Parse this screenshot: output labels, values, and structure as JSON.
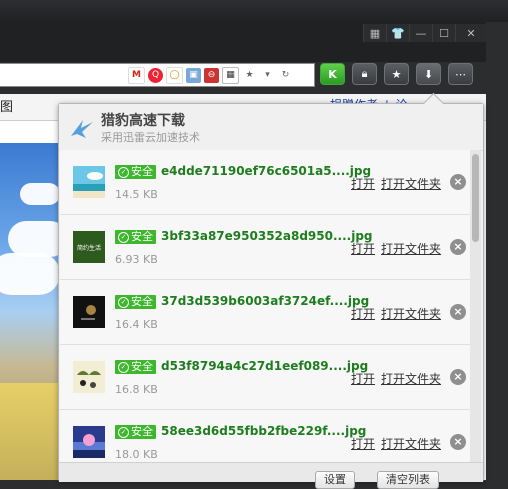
{
  "browser": {
    "window_buttons": [
      "▦",
      "👕",
      "—",
      "☐",
      "✕"
    ],
    "toolbar": {
      "k_label": "K",
      "lock_icon": "lock-icon",
      "star_icon": "star-icon",
      "download_icon": "download-icon",
      "menu_icon": "menu-icon"
    },
    "bookmarks": {
      "left_text": "图",
      "right_text": "捐赠作者  ↓ 论"
    }
  },
  "panel": {
    "title": "猎豹高速下载",
    "subtitle": "采用迅雷云加速技术",
    "safe_label": "安全",
    "open_label": "打开",
    "open_folder_label": "打开文件夹",
    "items": [
      {
        "name": "e4dde71190ef76c6501a5....jpg",
        "size": "14.5 KB",
        "thumb_text": ""
      },
      {
        "name": "3bf33a87e950352a8d950....jpg",
        "size": "6.93 KB",
        "thumb_text": "简约生活"
      },
      {
        "name": "37d3d539b6003af3724ef....jpg",
        "size": "16.4 KB",
        "thumb_text": ""
      },
      {
        "name": "d53f8794a4c27d1eef089....jpg",
        "size": "16.8 KB",
        "thumb_text": ""
      },
      {
        "name": "58ee3d6d55fbb2fbe229f....jpg",
        "size": "18.0 KB",
        "thumb_text": ""
      }
    ],
    "footer": {
      "settings_label": "设置",
      "clear_label": "清空列表"
    }
  }
}
